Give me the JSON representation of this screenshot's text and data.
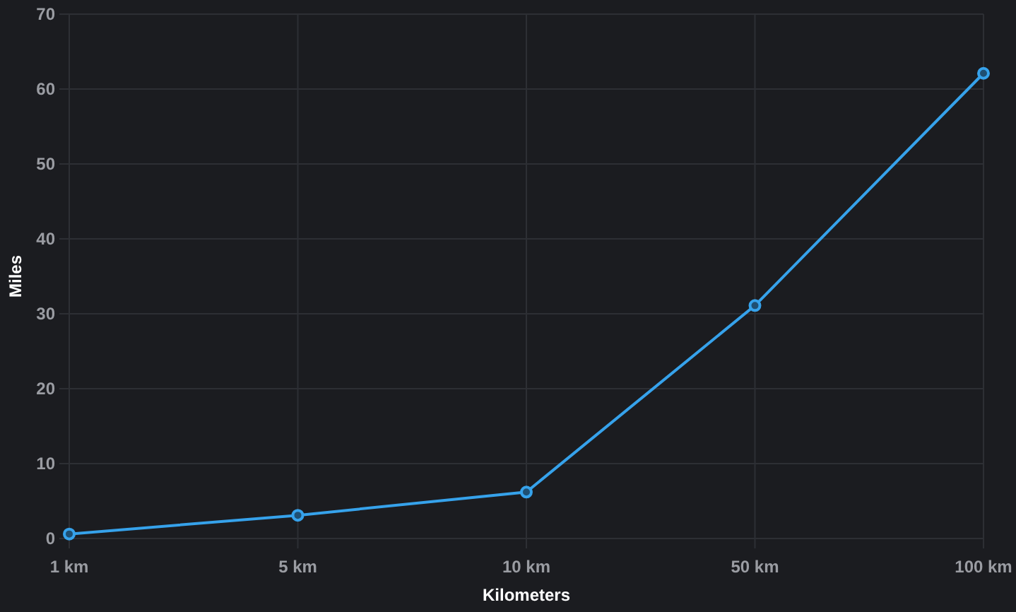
{
  "chart": {
    "chart_data": {
      "type": "line",
      "xlabel": "Kilometers",
      "ylabel": "Miles",
      "grid": true,
      "categories": [
        "1 km",
        "5 km",
        "10 km",
        "50 km",
        "100 km"
      ],
      "series": [
        {
          "color": "#36a2eb",
          "marker": true,
          "values": [
            0.6,
            3.1,
            6.2,
            31.1,
            62.1
          ]
        }
      ],
      "ylim": [
        0,
        70
      ],
      "yticks": [
        0,
        10,
        20,
        30,
        40,
        50,
        60,
        70
      ]
    }
  }
}
